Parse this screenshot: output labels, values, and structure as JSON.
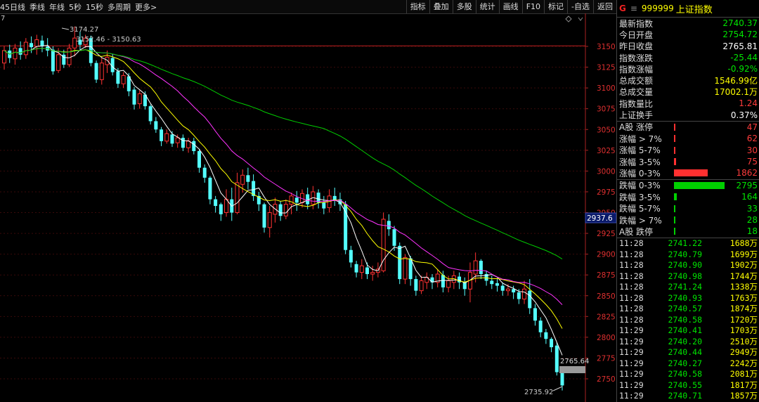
{
  "toolbar": {
    "left": [
      "45日线",
      "季线",
      "年线",
      "5秒",
      "15秒",
      "多周期",
      "更多>"
    ],
    "right": [
      "指标",
      "叠加",
      "多股",
      "统计",
      "画线",
      "F10",
      "标记",
      "-自选",
      "返回"
    ]
  },
  "chart": {
    "corner_label": "7",
    "price_axis": [
      3150,
      3125,
      3100,
      3075,
      3050,
      3025,
      3000,
      2975,
      2950,
      2925,
      2900,
      2875,
      2850,
      2825,
      2800,
      2775,
      2750
    ],
    "current_price_tag": "2937.6",
    "high_annotation": "3174.27",
    "range_annotation": "3152.46 - 3150.63",
    "prev_close_tag": "2765.64",
    "low_annotation": "2735.92",
    "hline_value": 3150.6,
    "candles": [
      [
        3130,
        3145,
        3122,
        3150
      ],
      [
        3145,
        3136,
        3130,
        3152
      ],
      [
        3135,
        3148,
        3128,
        3153
      ],
      [
        3148,
        3140,
        3134,
        3156
      ],
      [
        3140,
        3155,
        3135,
        3160
      ],
      [
        3154,
        3149,
        3142,
        3162
      ],
      [
        3150,
        3158,
        3140,
        3164
      ],
      [
        3157,
        3150,
        3143,
        3163
      ],
      [
        3150,
        3145,
        3138,
        3160
      ],
      [
        3146,
        3120,
        3116,
        3150
      ],
      [
        3121,
        3140,
        3118,
        3148
      ],
      [
        3140,
        3128,
        3124,
        3146
      ],
      [
        3128,
        3148,
        3125,
        3153
      ],
      [
        3148,
        3160,
        3138,
        3174
      ],
      [
        3158,
        3152,
        3146,
        3168
      ],
      [
        3152,
        3160,
        3148,
        3164
      ],
      [
        3160,
        3130,
        3126,
        3163
      ],
      [
        3130,
        3110,
        3106,
        3133
      ],
      [
        3110,
        3130,
        3104,
        3136
      ],
      [
        3128,
        3137,
        3118,
        3145
      ],
      [
        3136,
        3119,
        3115,
        3141
      ],
      [
        3120,
        3105,
        3100,
        3124
      ],
      [
        3105,
        3115,
        3100,
        3119
      ],
      [
        3114,
        3096,
        3090,
        3118
      ],
      [
        3098,
        3080,
        3074,
        3101
      ],
      [
        3081,
        3093,
        3075,
        3097
      ],
      [
        3092,
        3078,
        3074,
        3096
      ],
      [
        3078,
        3060,
        3056,
        3080
      ],
      [
        3060,
        3050,
        3046,
        3065
      ],
      [
        3050,
        3036,
        3030,
        3053
      ],
      [
        3036,
        3045,
        3033,
        3050
      ],
      [
        3044,
        3033,
        3029,
        3048
      ],
      [
        3034,
        3040,
        3028,
        3044
      ],
      [
        3040,
        3028,
        3024,
        3044
      ],
      [
        3028,
        3036,
        3022,
        3040
      ],
      [
        3036,
        3024,
        3020,
        3040
      ],
      [
        3024,
        3004,
        2998,
        3026
      ],
      [
        3004,
        2992,
        2986,
        3008
      ],
      [
        2992,
        2966,
        2960,
        2994
      ],
      [
        2966,
        2958,
        2950,
        2970
      ],
      [
        2960,
        2948,
        2940,
        2962
      ],
      [
        2950,
        2966,
        2945,
        2978
      ],
      [
        2966,
        2950,
        2940,
        2980
      ],
      [
        2950,
        2986,
        2948,
        2998
      ],
      [
        2984,
        2995,
        2974,
        3002
      ],
      [
        2995,
        2987,
        2978,
        3004
      ],
      [
        2988,
        2970,
        2964,
        2996
      ],
      [
        2970,
        2960,
        2952,
        2975
      ],
      [
        2960,
        2932,
        2926,
        2962
      ],
      [
        2932,
        2950,
        2920,
        2958
      ],
      [
        2948,
        2960,
        2938,
        2968
      ],
      [
        2960,
        2946,
        2940,
        2964
      ],
      [
        2946,
        2960,
        2942,
        2966
      ],
      [
        2960,
        2970,
        2948,
        2974
      ],
      [
        2968,
        2962,
        2952,
        2976
      ],
      [
        2962,
        2973,
        2956,
        2978
      ],
      [
        2972,
        2960,
        2954,
        2980
      ],
      [
        2960,
        2975,
        2954,
        2982
      ],
      [
        2974,
        2962,
        2955,
        2978
      ],
      [
        2962,
        2955,
        2948,
        2970
      ],
      [
        2956,
        2970,
        2950,
        2978
      ],
      [
        2970,
        2964,
        2958,
        2980
      ],
      [
        2966,
        2960,
        2952,
        2974
      ],
      [
        2960,
        2905,
        2900,
        2964
      ],
      [
        2905,
        2890,
        2884,
        2910
      ],
      [
        2888,
        2878,
        2872,
        2892
      ],
      [
        2878,
        2886,
        2870,
        2894
      ],
      [
        2884,
        2876,
        2870,
        2890
      ],
      [
        2876,
        2878,
        2868,
        2886
      ],
      [
        2878,
        2882,
        2872,
        2890
      ],
      [
        2880,
        2942,
        2878,
        2950
      ],
      [
        2940,
        2930,
        2922,
        2948
      ],
      [
        2930,
        2910,
        2904,
        2934
      ],
      [
        2910,
        2870,
        2864,
        2914
      ],
      [
        2870,
        2896,
        2864,
        2900
      ],
      [
        2895,
        2870,
        2862,
        2898
      ],
      [
        2870,
        2856,
        2850,
        2874
      ],
      [
        2856,
        2868,
        2852,
        2874
      ],
      [
        2866,
        2872,
        2858,
        2878
      ],
      [
        2872,
        2866,
        2858,
        2876
      ],
      [
        2866,
        2876,
        2860,
        2882
      ],
      [
        2875,
        2860,
        2854,
        2880
      ],
      [
        2860,
        2868,
        2854,
        2874
      ],
      [
        2866,
        2874,
        2858,
        2880
      ],
      [
        2873,
        2866,
        2858,
        2878
      ],
      [
        2866,
        2858,
        2850,
        2872
      ],
      [
        2858,
        2878,
        2842,
        2890
      ],
      [
        2876,
        2892,
        2866,
        2902
      ],
      [
        2892,
        2876,
        2870,
        2894
      ],
      [
        2876,
        2868,
        2862,
        2880
      ],
      [
        2868,
        2864,
        2858,
        2874
      ],
      [
        2865,
        2862,
        2855,
        2870
      ],
      [
        2862,
        2856,
        2850,
        2866
      ],
      [
        2856,
        2858,
        2850,
        2864
      ],
      [
        2858,
        2854,
        2846,
        2862
      ],
      [
        2854,
        2846,
        2840,
        2858
      ],
      [
        2846,
        2858,
        2840,
        2868
      ],
      [
        2856,
        2835,
        2828,
        2870
      ],
      [
        2835,
        2820,
        2814,
        2840
      ],
      [
        2820,
        2806,
        2800,
        2824
      ],
      [
        2806,
        2798,
        2792,
        2810
      ],
      [
        2798,
        2788,
        2782,
        2800
      ],
      [
        2790,
        2758,
        2754,
        2794
      ],
      [
        2758,
        2742,
        2735.9,
        2762
      ]
    ]
  },
  "panel": {
    "code_prefix": "G",
    "menu_glyph": "≡",
    "code": "999999",
    "name": "上证指数",
    "stats": [
      {
        "label": "最新指数",
        "value": "2740.37",
        "color": "grn"
      },
      {
        "label": "今日开盘",
        "value": "2754.72",
        "color": "grn"
      },
      {
        "label": "昨日收盘",
        "value": "2765.81",
        "color": "wht"
      },
      {
        "label": "指数涨跌",
        "value": "-25.44",
        "color": "grn"
      },
      {
        "label": "指数涨幅",
        "value": "-0.92%",
        "color": "grn"
      },
      {
        "label": "总成交额",
        "value": "1546.99亿",
        "color": "yel"
      },
      {
        "label": "总成交量",
        "value": "17002.1万",
        "color": "yel"
      },
      {
        "label": "指数量比",
        "value": "1.24",
        "color": "red"
      },
      {
        "label": "上证换手",
        "value": "0.37%",
        "color": "wht"
      }
    ],
    "up_dist": [
      {
        "label": "A股 涨停",
        "value": "47",
        "bar": 2
      },
      {
        "label": "涨幅 > 7%",
        "value": "62",
        "bar": 2
      },
      {
        "label": "涨幅 5-7%",
        "value": "30",
        "bar": 2
      },
      {
        "label": "涨幅 3-5%",
        "value": "75",
        "bar": 3
      },
      {
        "label": "涨幅 0-3%",
        "value": "1862",
        "bar": 48
      }
    ],
    "down_dist": [
      {
        "label": "跌幅 0-3%",
        "value": "2795",
        "bar": 72
      },
      {
        "label": "跌幅 3-5%",
        "value": "164",
        "bar": 4
      },
      {
        "label": "跌幅 5-7%",
        "value": "33",
        "bar": 2
      },
      {
        "label": "跌幅 > 7%",
        "value": "28",
        "bar": 2
      },
      {
        "label": "A股 跌停",
        "value": "18",
        "bar": 2
      }
    ],
    "ticks": [
      {
        "t": "11:28",
        "p": "2741.22",
        "v": "1688万"
      },
      {
        "t": "11:28",
        "p": "2740.79",
        "v": "1699万"
      },
      {
        "t": "11:28",
        "p": "2740.90",
        "v": "1902万"
      },
      {
        "t": "11:28",
        "p": "2740.98",
        "v": "1744万"
      },
      {
        "t": "11:28",
        "p": "2741.24",
        "v": "1338万"
      },
      {
        "t": "11:28",
        "p": "2740.93",
        "v": "1763万"
      },
      {
        "t": "11:28",
        "p": "2740.57",
        "v": "1874万"
      },
      {
        "t": "11:28",
        "p": "2740.58",
        "v": "1720万"
      },
      {
        "t": "11:29",
        "p": "2740.41",
        "v": "1703万"
      },
      {
        "t": "11:29",
        "p": "2740.20",
        "v": "2510万"
      },
      {
        "t": "11:29",
        "p": "2740.44",
        "v": "2949万"
      },
      {
        "t": "11:29",
        "p": "2740.27",
        "v": "2242万"
      },
      {
        "t": "11:29",
        "p": "2740.58",
        "v": "2081万"
      },
      {
        "t": "11:29",
        "p": "2740.55",
        "v": "1817万"
      },
      {
        "t": "11:29",
        "p": "2740.71",
        "v": "1857万"
      }
    ]
  }
}
